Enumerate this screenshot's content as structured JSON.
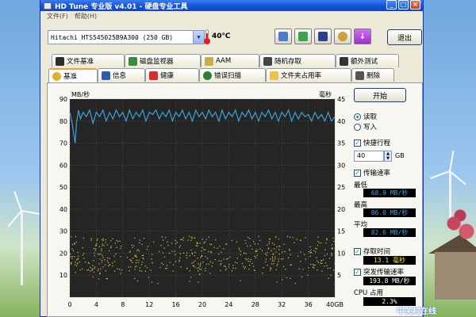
{
  "window": {
    "title": "HD Tune 专业版 v4.01 - 硬盘专业工具",
    "menu": [
      "文件(F)",
      "帮助(H)"
    ],
    "controls": {
      "minimize": "_",
      "maximize": "□",
      "close": "×"
    }
  },
  "toolbar": {
    "drive": "Hitachi HTS545025B9A300 (250 GB)",
    "temperature": "40℃",
    "icons": [
      "copy-icon",
      "copy-text-icon",
      "save-icon",
      "options-icon",
      "download-icon"
    ],
    "exit_label": "退出"
  },
  "tabs": {
    "row1": [
      "文件基准",
      "磁盘监视器",
      "AAM",
      "随机存取",
      "额外测试"
    ],
    "row2": [
      "基准",
      "信息",
      "健康",
      "错误扫描",
      "文件夹占用率",
      "删除"
    ],
    "active": "基准"
  },
  "side": {
    "start_label": "开始",
    "read_label": "读取",
    "write_label": "写入",
    "quick_label": "快捷行程",
    "quick_value": "40",
    "quick_unit": "GB",
    "transfer_label": "传输速率",
    "min_label": "最低",
    "min_value": "68.9 MB/秒",
    "max_label": "最高",
    "max_value": "86.0 MB/秒",
    "avg_label": "平均",
    "avg_value": "82.6 MB/秒",
    "access_label": "存取时间",
    "access_value": "13.1 毫秒",
    "burst_label": "突发传输速率",
    "burst_value": "193.8 MB/秒",
    "cpu_label": "CPU 占用",
    "cpu_value": "2.3%"
  },
  "watermark": "中关村在线",
  "chart_data": {
    "type": "line",
    "background": "#252525",
    "y_left_label": "MB/秒",
    "y_right_label": "毫秒",
    "y_left_ticks": [
      "90",
      "80",
      "70",
      "60",
      "50",
      "40",
      "30",
      "20",
      "10"
    ],
    "y_right_ticks": [
      "45",
      "40",
      "35",
      "30",
      "25",
      "20",
      "15",
      "10",
      "5"
    ],
    "x_ticks": [
      "0",
      "4",
      "8",
      "12",
      "16",
      "20",
      "24",
      "28",
      "32",
      "36",
      "40GB"
    ],
    "xlim": [
      0,
      40
    ],
    "ylim_left": [
      0,
      90
    ],
    "ylim_right": [
      0,
      45
    ],
    "grid": true,
    "series": [
      {
        "color": "#3fa0d8",
        "axis": "left",
        "x": [
          0,
          0.3,
          0.5,
          0.8,
          1.0,
          1.3,
          1.6,
          2.0,
          2.5,
          3,
          3.5,
          4,
          4.5,
          5,
          5.5,
          6,
          6.5,
          7,
          7.5,
          8,
          8.5,
          9,
          9.5,
          10,
          10.5,
          11,
          11.5,
          12,
          12.5,
          13,
          13.5,
          14,
          14.5,
          15,
          15.5,
          16,
          16.5,
          17,
          17.5,
          18,
          18.5,
          19,
          19.5,
          20,
          20.5,
          21,
          21.5,
          22,
          22.5,
          23,
          23.5,
          24,
          24.5,
          25,
          25.5,
          26,
          26.5,
          27,
          27.5,
          28,
          28.5,
          29,
          29.5,
          30,
          30.5,
          31,
          31.5,
          32,
          32.5,
          33,
          33.5,
          34,
          34.5,
          35,
          35.5,
          36,
          36.5,
          37,
          37.5,
          38,
          38.5,
          39,
          39.5,
          40
        ],
        "y": [
          84,
          80,
          76,
          70,
          79,
          85,
          81,
          84,
          82,
          85,
          79,
          84,
          82,
          85,
          80,
          84,
          81,
          85,
          82,
          84,
          80,
          85,
          81,
          84,
          82,
          85,
          80,
          84,
          83,
          85,
          81,
          84,
          82,
          85,
          80,
          84,
          82,
          85,
          81,
          84,
          80,
          85,
          82,
          84,
          81,
          85,
          82,
          84,
          80,
          85,
          81,
          84,
          82,
          85,
          80,
          84,
          82,
          85,
          81,
          84,
          80,
          84,
          82,
          85,
          81,
          84,
          80,
          84,
          82,
          85,
          80,
          84,
          81,
          84,
          82,
          83,
          80,
          84,
          81,
          83,
          80,
          84,
          80,
          82
        ]
      },
      {
        "color": "#d8cf3c",
        "axis": "right",
        "marker": "point",
        "note": "access time scatter, values mostly 7–15 ms"
      }
    ]
  }
}
